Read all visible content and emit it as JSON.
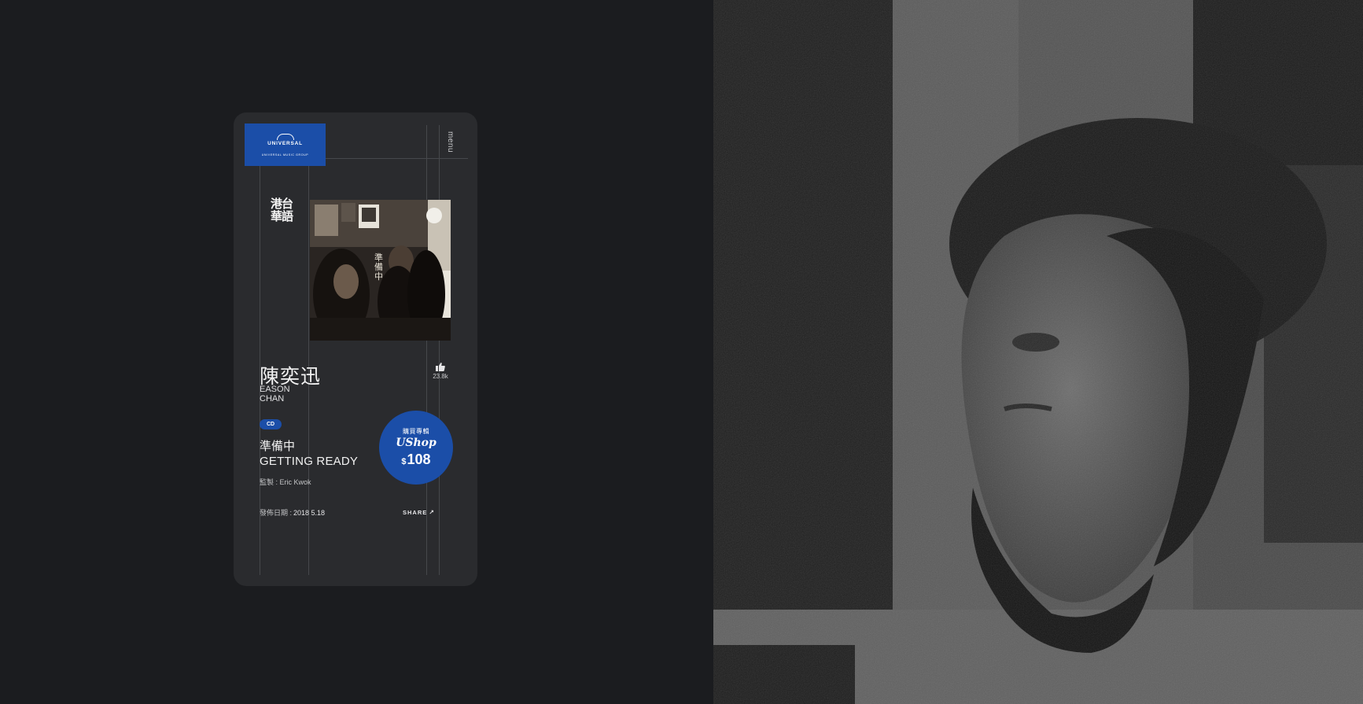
{
  "brand": {
    "logo_word": "UNIVERSAL",
    "logo_sub": "UNIVERSAL MUSIC GROUP",
    "accent_color": "#1b4ea8"
  },
  "nav": {
    "menu_label": "menu"
  },
  "section_calligraphy": "港台華語",
  "album": {
    "cover_text": "準備中"
  },
  "artist": {
    "name_cn": "陳奕迅",
    "name_en_line1": "EASON",
    "name_en_line2": "CHAN"
  },
  "likes": {
    "icon": "thumbs-up-icon",
    "count": "23.8k"
  },
  "product": {
    "format_badge": "CD",
    "title_cn": "準備中",
    "title_en": "GETTING READY",
    "producer_label": "監製 :",
    "producer": "Eric Kwok",
    "release_label": "發佈日期 :",
    "release_date": "2018 5.18"
  },
  "buy": {
    "label": "購買專輯",
    "shop": "UShop",
    "currency": "$",
    "price": "108"
  },
  "share": {
    "label": "SHARE",
    "icon": "share-arrow-icon"
  }
}
